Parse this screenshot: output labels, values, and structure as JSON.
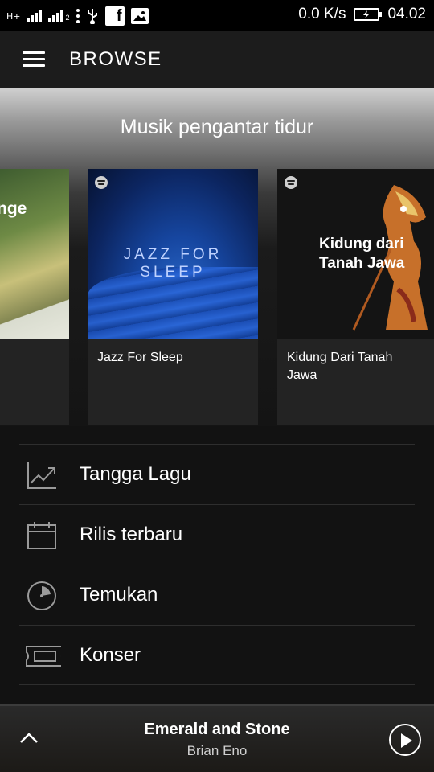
{
  "status_bar": {
    "network_label": "H+",
    "sim2_label": "2",
    "speed": "0.0 K/s",
    "time": "04.02"
  },
  "header": {
    "title": "BROWSE",
    "menu_icon": "hamburger-menu-icon"
  },
  "hero": {
    "section_title": "Musik pengantar tidur",
    "cards": [
      {
        "title": "",
        "art_text": "nge"
      },
      {
        "title": "Jazz For Sleep",
        "art_text": "JAZZ FOR SLEEP"
      },
      {
        "title": "Kidung Dari Tanah Jawa",
        "art_text": "Kidung dari Tanah Jawa"
      }
    ]
  },
  "browse_list": {
    "items": [
      {
        "label": "Tangga Lagu",
        "icon": "chart-trend-icon"
      },
      {
        "label": "Rilis terbaru",
        "icon": "calendar-icon"
      },
      {
        "label": "Temukan",
        "icon": "discover-dial-icon"
      },
      {
        "label": "Konser",
        "icon": "ticket-icon"
      }
    ]
  },
  "player": {
    "track": "Emerald and Stone",
    "artist": "Brian Eno",
    "expand_icon": "chevron-up-icon",
    "play_icon": "play-icon"
  },
  "colors": {
    "background": "#121212",
    "appbar": "#1c1c1c",
    "card": "#232323",
    "divider": "#2e2e2e",
    "text": "#ffffff"
  }
}
